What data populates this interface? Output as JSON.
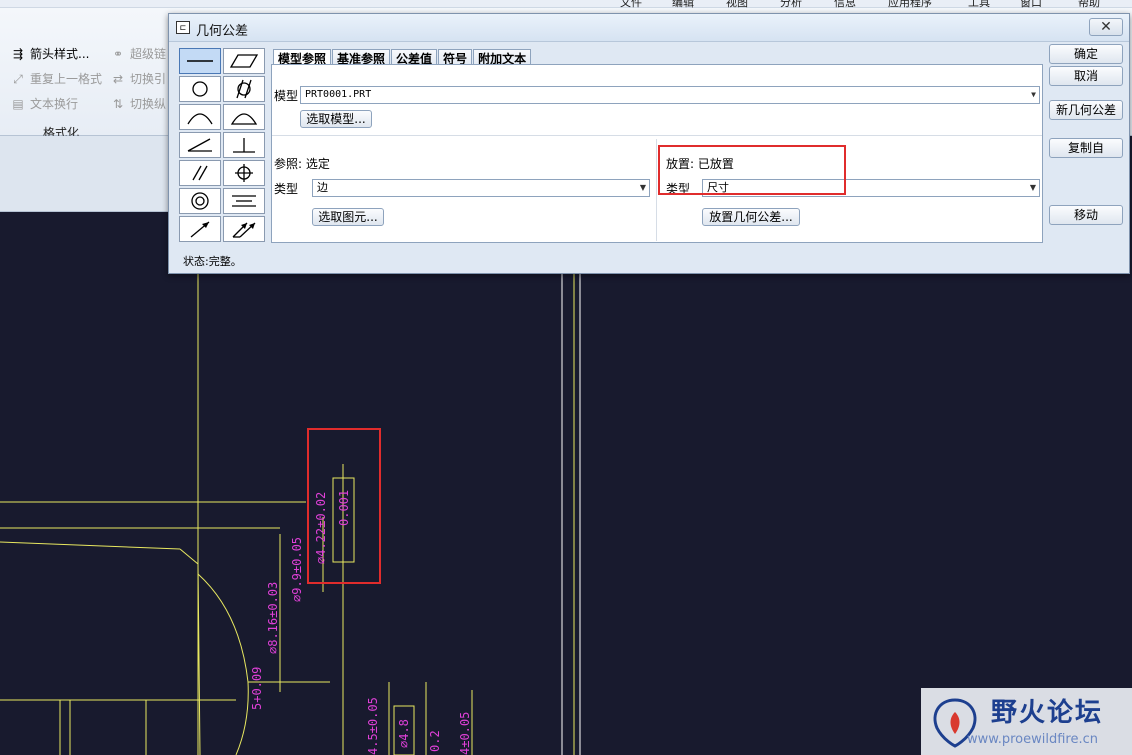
{
  "app": {
    "menu": [
      "文件",
      "编辑",
      "视图",
      "分析",
      "信息",
      "应用程序",
      "工具",
      "窗口",
      "帮助"
    ]
  },
  "ribbon": {
    "items": [
      {
        "label": "箭头样式...",
        "enabled": true
      },
      {
        "label": "超级链",
        "enabled": false
      },
      {
        "label": "重复上一格式",
        "enabled": false
      },
      {
        "label": "切换引",
        "enabled": false
      },
      {
        "label": "文本换行",
        "enabled": false
      },
      {
        "label": "切换纵",
        "enabled": false
      }
    ],
    "group_label": "格式化"
  },
  "dialog": {
    "title": "几何公差",
    "close_label": "✕",
    "tabs": [
      {
        "label": "模型参照",
        "active": true
      },
      {
        "label": "基准参照",
        "active": false
      },
      {
        "label": "公差值",
        "active": false
      },
      {
        "label": "符号",
        "active": false
      },
      {
        "label": "附加文本",
        "active": false
      }
    ],
    "model": {
      "label": "模型",
      "value": "PRT0001.PRT",
      "select_button": "选取模型..."
    },
    "reference": {
      "header": "参照: 选定",
      "type_label": "类型",
      "type_value": "边",
      "select_button": "选取图元..."
    },
    "placement": {
      "header": "放置: 已放置",
      "type_label": "类型",
      "type_value": "尺寸",
      "place_button": "放置几何公差..."
    },
    "side_buttons": {
      "ok": "确定",
      "cancel": "取消",
      "new": "新几何公差",
      "copy": "复制自",
      "move": "移动"
    },
    "status": "状态:完整。"
  },
  "drawing": {
    "dims": [
      "⌀4.22±0.02",
      "0.001",
      "⌀9.9±0.05",
      "⌀8.16±0.03",
      "5+0.09",
      "4.5±0.05",
      "⌀4.8",
      "0.2",
      "4±0.05"
    ]
  },
  "watermark": {
    "text": "野火论坛",
    "url": "www.proewildfire.cn"
  },
  "colors": {
    "canvas": "#181a2e",
    "geometry": "#e8e860",
    "dimension": "#e040d8",
    "highlight": "#e02c2c"
  }
}
